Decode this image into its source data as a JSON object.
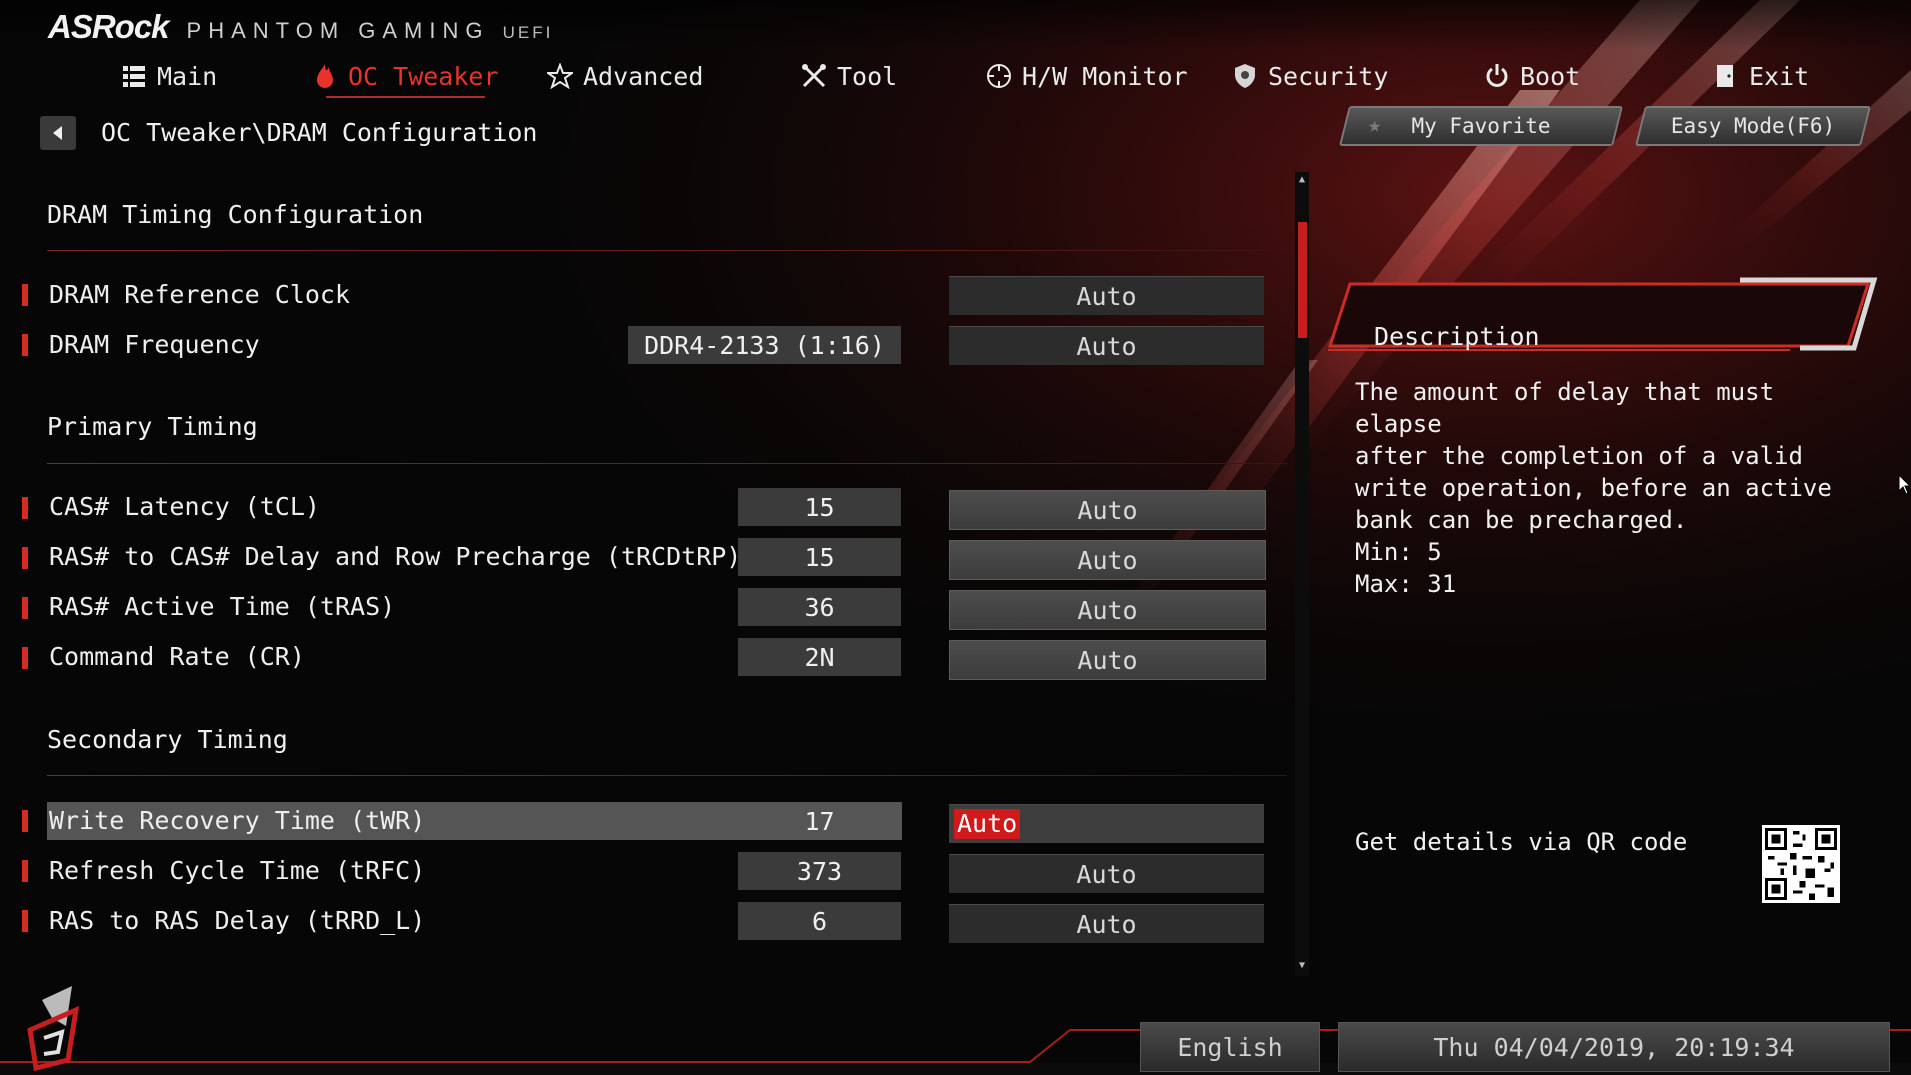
{
  "brand": {
    "logo": "ASRock",
    "line": "PHANTOM GAMING",
    "uefi": "UEFI"
  },
  "nav": [
    {
      "id": "main",
      "label": "Main",
      "icon": "list-icon"
    },
    {
      "id": "oc",
      "label": "OC Tweaker",
      "icon": "flame-icon",
      "active": true
    },
    {
      "id": "advanced",
      "label": "Advanced",
      "icon": "star-icon"
    },
    {
      "id": "tool",
      "label": "Tool",
      "icon": "tools-icon"
    },
    {
      "id": "hwmon",
      "label": "H/W Monitor",
      "icon": "gauge-icon"
    },
    {
      "id": "security",
      "label": "Security",
      "icon": "shield-icon"
    },
    {
      "id": "boot",
      "label": "Boot",
      "icon": "power-icon"
    },
    {
      "id": "exit",
      "label": "Exit",
      "icon": "exit-door-icon"
    }
  ],
  "breadcrumb": "OC Tweaker\\DRAM Configuration",
  "buttons": {
    "favorite": "My Favorite",
    "easy_mode": "Easy Mode(F6)"
  },
  "sections": {
    "dram_timing": "DRAM Timing Configuration",
    "primary": "Primary Timing",
    "secondary": "Secondary Timing"
  },
  "rows": {
    "ref_clock": {
      "label": "DRAM Reference Clock",
      "option": "Auto"
    },
    "frequency": {
      "label": "DRAM Frequency",
      "value": "DDR4-2133 (1:16)",
      "option": "Auto"
    },
    "tcl": {
      "label": "CAS# Latency (tCL)",
      "value": "15",
      "option": "Auto"
    },
    "trcdtrp": {
      "label": "RAS# to CAS# Delay and Row Precharge (tRCDtRP)",
      "value": "15",
      "option": "Auto"
    },
    "tras": {
      "label": "RAS# Active Time (tRAS)",
      "value": "36",
      "option": "Auto"
    },
    "cr": {
      "label": "Command Rate (CR)",
      "value": "2N",
      "option": "Auto"
    },
    "twr": {
      "label": "Write Recovery Time (tWR)",
      "value": "17",
      "option": "Auto"
    },
    "trfc": {
      "label": "Refresh Cycle Time (tRFC)",
      "value": "373",
      "option": "Auto"
    },
    "trrd": {
      "label": "RAS to RAS Delay (tRRD_L)",
      "value": "6",
      "option": "Auto"
    }
  },
  "description": {
    "title": "Description",
    "text": "The amount of delay that must elapse\nafter the completion of a valid\nwrite operation, before an active\nbank can be precharged.",
    "min": "Min: 5",
    "max": "Max: 31",
    "qr_text": "Get details via QR code"
  },
  "footer": {
    "language": "English",
    "datetime": "Thu 04/04/2019, 20:19:34"
  },
  "colors": {
    "accent": "#d42b22",
    "selected_bg": "#d0191b",
    "panel": "#3b3b3b"
  }
}
